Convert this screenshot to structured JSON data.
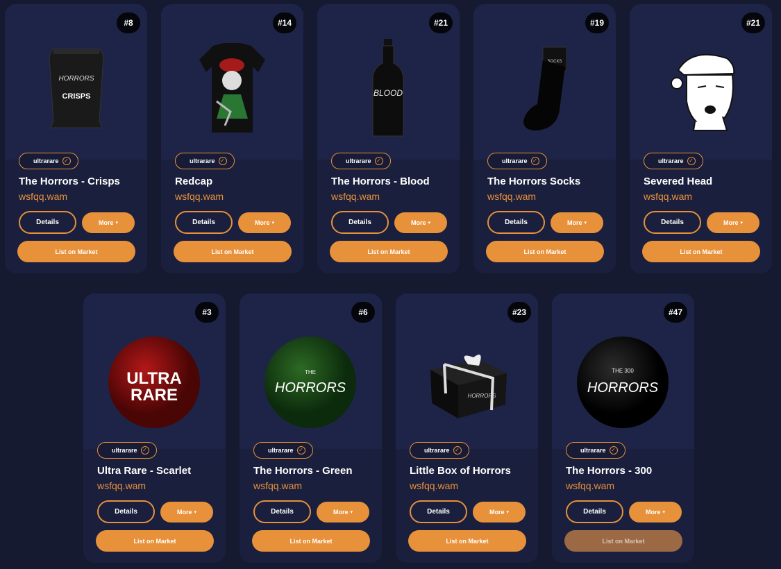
{
  "owner": "wsfqq.wam",
  "labels": {
    "details": "Details",
    "more": "More",
    "list": "List on Market",
    "rarity": "ultrarare"
  },
  "colors": {
    "accent": "#e8913b",
    "background": "#151a30",
    "card": "#1b2040"
  },
  "cards": [
    {
      "name": "The Horrors - Crisps",
      "number": "#8",
      "rarity": "ultrarare",
      "owner": "wsfqq.wam",
      "image": "crisps-bag",
      "list_enabled": true
    },
    {
      "name": "Redcap",
      "number": "#14",
      "rarity": "ultrarare",
      "owner": "wsfqq.wam",
      "image": "redcap-shirt",
      "list_enabled": true
    },
    {
      "name": "The Horrors - Blood",
      "number": "#21",
      "rarity": "ultrarare",
      "owner": "wsfqq.wam",
      "image": "blood-bottle",
      "list_enabled": true
    },
    {
      "name": "The Horrors Socks",
      "number": "#19",
      "rarity": "ultrarare",
      "owner": "wsfqq.wam",
      "image": "socks",
      "list_enabled": true
    },
    {
      "name": "Severed Head",
      "number": "#21",
      "rarity": "ultrarare",
      "owner": "wsfqq.wam",
      "image": "severed-head",
      "list_enabled": true
    },
    {
      "name": "Ultra Rare - Scarlet",
      "number": "#3",
      "rarity": "ultrarare",
      "owner": "wsfqq.wam",
      "image": "scarlet-badge",
      "list_enabled": true
    },
    {
      "name": "The Horrors - Green",
      "number": "#6",
      "rarity": "ultrarare",
      "owner": "wsfqq.wam",
      "image": "green-badge",
      "list_enabled": true
    },
    {
      "name": "Little Box of Horrors",
      "number": "#23",
      "rarity": "ultrarare",
      "owner": "wsfqq.wam",
      "image": "gift-box",
      "list_enabled": true
    },
    {
      "name": "The Horrors - 300",
      "number": "#47",
      "rarity": "ultrarare",
      "owner": "wsfqq.wam",
      "image": "black-badge",
      "list_enabled": false
    }
  ],
  "art_text": {
    "crisps_brand": "HORRORS",
    "crisps_label": "CRISPS",
    "blood_label": "BLOOD",
    "socks_label": "SOCKS",
    "scarlet_line1": "ULTRA",
    "scarlet_line2": "RARE",
    "green_small": "THE",
    "green_main": "HORRORS",
    "black_small": "THE 300",
    "black_main": "HORRORS",
    "box_label": "HORRORS"
  }
}
